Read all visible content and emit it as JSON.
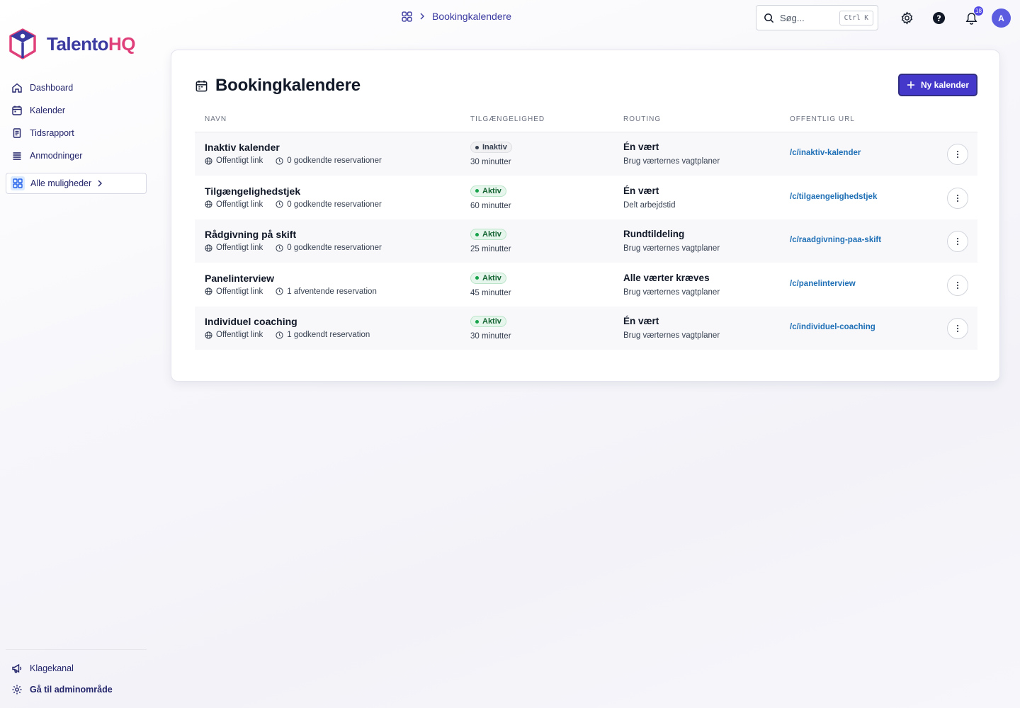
{
  "brand": {
    "name_part1": "Talento",
    "name_part2": "HQ"
  },
  "sidebar": {
    "items": [
      {
        "label": "Dashboard",
        "icon": "home-icon"
      },
      {
        "label": "Kalender",
        "icon": "calendar-icon"
      },
      {
        "label": "Tidsrapport",
        "icon": "document-icon"
      },
      {
        "label": "Anmodninger",
        "icon": "list-icon"
      }
    ],
    "all_options": "Alle muligheder",
    "bottom": [
      {
        "label": "Klagekanal",
        "icon": "megaphone-icon"
      },
      {
        "label": "Gå til adminområde",
        "icon": "gear-icon"
      }
    ]
  },
  "topbar": {
    "breadcrumb": "Bookingkalendere",
    "search_placeholder": "Søg...",
    "search_shortcut": "Ctrl K",
    "notification_count": "18",
    "avatar_initial": "A"
  },
  "page": {
    "title": "Bookingkalendere",
    "new_button": "Ny kalender"
  },
  "table": {
    "headers": {
      "name": "NAVN",
      "availability": "TILGÆNGELIGHED",
      "routing": "ROUTING",
      "url": "OFFENTLIG URL"
    },
    "rows": [
      {
        "name": "Inaktiv kalender",
        "link": "Offentligt link",
        "reservations": "0 godkendte reservationer",
        "status": "Inaktiv",
        "status_type": "inactive",
        "duration": "30 minutter",
        "routing": "Én vært",
        "routing_sub": "Brug værternes vagtplaner",
        "url": "/c/inaktiv-kalender"
      },
      {
        "name": "Tilgængelighedstjek",
        "link": "Offentligt link",
        "reservations": "0 godkendte reservationer",
        "status": "Aktiv",
        "status_type": "active",
        "duration": "60 minutter",
        "routing": "Én vært",
        "routing_sub": "Delt arbejdstid",
        "url": "/c/tilgaengelighedstjek"
      },
      {
        "name": "Rådgivning på skift",
        "link": "Offentligt link",
        "reservations": "0 godkendte reservationer",
        "status": "Aktiv",
        "status_type": "active",
        "duration": "25 minutter",
        "routing": "Rundtildeling",
        "routing_sub": "Brug værternes vagtplaner",
        "url": "/c/raadgivning-paa-skift"
      },
      {
        "name": "Panelinterview",
        "link": "Offentligt link",
        "reservations": "1 afventende reservation",
        "status": "Aktiv",
        "status_type": "active",
        "duration": "45 minutter",
        "routing": "Alle værter kræves",
        "routing_sub": "Brug værternes vagtplaner",
        "url": "/c/panelinterview"
      },
      {
        "name": "Individuel coaching",
        "link": "Offentligt link",
        "reservations": "1 godkendt reservation",
        "status": "Aktiv",
        "status_type": "active",
        "duration": "30 minutter",
        "routing": "Én vært",
        "routing_sub": "Brug værternes vagtplaner",
        "url": "/c/individuel-coaching"
      }
    ]
  },
  "colors": {
    "accent": "#4338ca",
    "brand_primary": "#3b3aa0",
    "brand_secondary": "#e0407a",
    "link": "#1e6fb5",
    "active": "#16a34a"
  }
}
